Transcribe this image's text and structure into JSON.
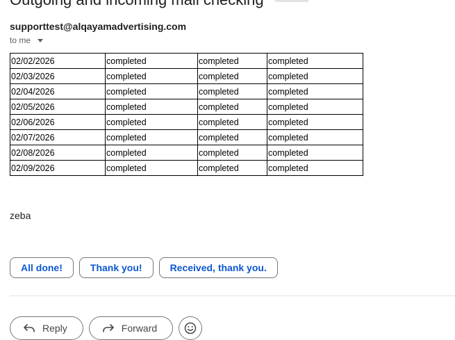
{
  "email": {
    "subject": "Outgoing and incoming mail checking",
    "sender": "supporttest@alqayamadvertising.com",
    "to_label": "to me",
    "signature": "zeba"
  },
  "status_table": {
    "rows": [
      [
        "02/02/2026",
        "completed",
        "completed",
        "completed"
      ],
      [
        "02/03/2026",
        "completed",
        "completed",
        "completed"
      ],
      [
        "02/04/2026",
        "completed",
        "completed",
        "completed"
      ],
      [
        "02/05/2026",
        "completed",
        "completed",
        "completed"
      ],
      [
        "02/06/2026",
        "completed",
        "completed",
        "completed"
      ],
      [
        "02/07/2026",
        "completed",
        "completed",
        "completed"
      ],
      [
        "02/08/2026",
        "completed",
        "completed",
        "completed"
      ],
      [
        "02/09/2026",
        "completed",
        "completed",
        "completed"
      ]
    ]
  },
  "smart_replies": [
    "All done!",
    "Thank you!",
    "Received, thank you."
  ],
  "actions": {
    "reply_label": "Reply",
    "forward_label": "Forward"
  },
  "icons": {
    "reply": "reply-icon",
    "forward": "forward-icon",
    "emoji": "emoji-icon",
    "caret": "chevron-down-icon"
  },
  "colors": {
    "accent": "#0b57d0",
    "text": "#1f1f1f",
    "muted": "#5e5e5e"
  }
}
